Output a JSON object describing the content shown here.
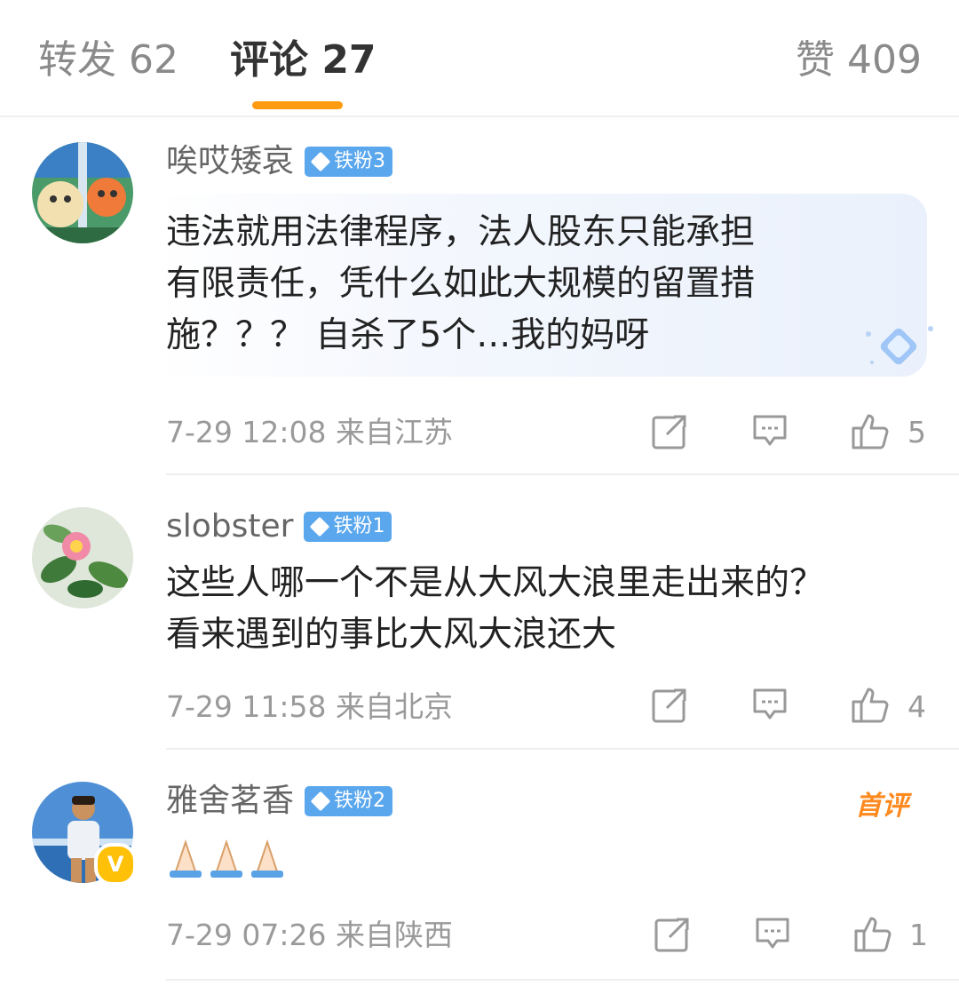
{
  "tabs": {
    "repost": "转发 62",
    "comments": "评论 27",
    "likes": "赞 409"
  },
  "comments": [
    {
      "username": "唉哎矮哀",
      "badge": "铁粉3",
      "text_lines": [
        "违法就用法律程序，法人股东只能承担",
        "有限责任，凭什么如此大规模的留置措",
        "施？？？ 自杀了5个…我的妈呀"
      ],
      "meta": "7-29 12:08  来自江苏",
      "likes": "5"
    },
    {
      "username": "slobster",
      "badge": "铁粉1",
      "text_lines": [
        "这些人哪一个不是从大风大浪里走出来的？",
        "看来遇到的事比大风大浪还大"
      ],
      "meta": "7-29 11:58  来自北京",
      "likes": "4"
    },
    {
      "username": "雅舍茗香",
      "badge": "铁粉2",
      "first_comment_label": "首评",
      "emoji": "🙏🙏🙏",
      "meta": "7-29 07:26  来自陕西",
      "likes": "1",
      "verified_mark": "V"
    }
  ],
  "icons": [
    "repost-icon",
    "comment-icon",
    "like-icon",
    "diamond-icon"
  ],
  "colors": {
    "accent": "#ff9b0f",
    "fan_badge": "#5aa7ee",
    "verified": "#ffc107",
    "first_comment": "#ff8a1f"
  }
}
